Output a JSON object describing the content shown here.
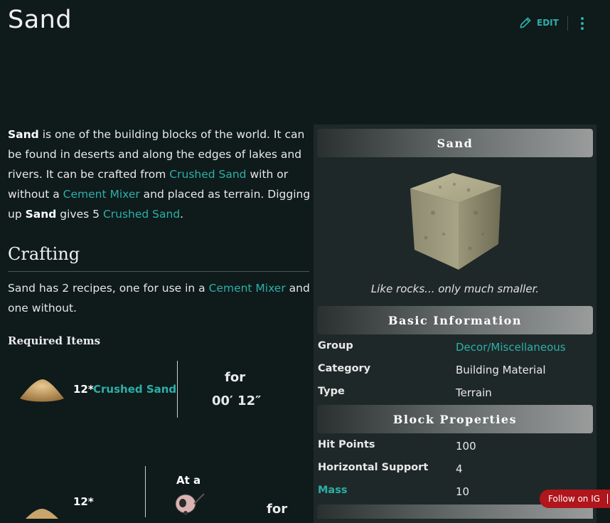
{
  "page": {
    "title": "Sand"
  },
  "toolbar": {
    "edit_label": "EDIT"
  },
  "intro": {
    "s1": "Sand",
    "s2": " is one of the building blocks of the world. It can be found in deserts and along the edges of lakes and rivers. It can be crafted from ",
    "link1": "Crushed Sand",
    "s3": " with or without a ",
    "link2": "Cement Mixer",
    "s4": " and placed as terrain. Digging up ",
    "s5": "Sand",
    "s6": " gives 5 ",
    "link3": "Crushed Sand",
    "s7": "."
  },
  "crafting": {
    "heading": "Crafting",
    "t1": "Sand has 2 recipes, one for use in a ",
    "link": "Cement Mixer",
    "t2": " and one without.",
    "required_label": "Required Items",
    "recipe1": {
      "qty": "12*",
      "item": "Crushed Sand",
      "for": "for",
      "time": "00′ 12″"
    },
    "recipe2": {
      "qty": "12*",
      "at": "At a",
      "for": "for"
    }
  },
  "infobox": {
    "title": "Sand",
    "caption": "Like rocks... only much smaller.",
    "basic_header": "Basic Information",
    "basic": [
      {
        "label": "Group",
        "value": "Decor/Miscellaneous",
        "link": true
      },
      {
        "label": "Category",
        "value": "Building Material",
        "link": false
      },
      {
        "label": "Type",
        "value": "Terrain",
        "link": false
      }
    ],
    "block_header": "Block Properties",
    "block": [
      {
        "label": "Hit Points",
        "value": "100",
        "link": false
      },
      {
        "label": "Horizontal Support",
        "value": "4",
        "link": false
      },
      {
        "label": "Mass",
        "value": "10",
        "link": true
      }
    ]
  },
  "follow": {
    "label": "Follow on IG"
  },
  "colors": {
    "accent": "#2bb0a8",
    "background": "#0f1a1a",
    "infobox": "#1f2828",
    "follow": "#b0161c"
  }
}
